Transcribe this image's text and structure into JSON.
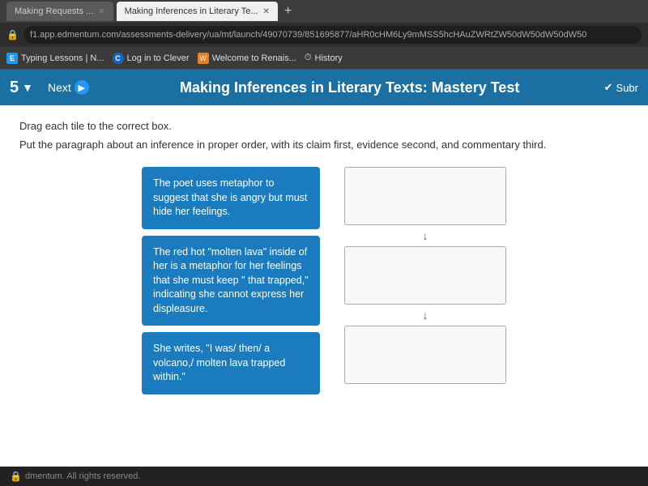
{
  "browser": {
    "tabs": [
      {
        "label": "Making Requests ...",
        "active": false
      },
      {
        "label": "Making Inferences in Literary Te...",
        "active": true
      }
    ],
    "address": "f1.app.edmentum.com/assessments-delivery/ua/mt/launch/49070739/851695877/aHR0cHM6Ly9mMSS5hcHAuZWRtZW50dW50dW50dW50",
    "bookmarks": [
      {
        "icon": "E",
        "label": "Typing Lessons | N...",
        "type": "e"
      },
      {
        "icon": "C",
        "label": "Log in to Clever",
        "type": "c"
      },
      {
        "icon": "W",
        "label": "Welcome to Renais...",
        "type": "w"
      },
      {
        "icon": "⏱",
        "label": "History",
        "type": "h"
      }
    ]
  },
  "header": {
    "question_number": "5",
    "next_label": "Next",
    "title": "Making Inferences in Literary Texts: Mastery Test",
    "submit_label": "Subr"
  },
  "content": {
    "drag_instruction": "Drag each tile to the correct box.",
    "order_instruction": "Put the paragraph about an inference in proper order, with its claim first, evidence second, and commentary third.",
    "tiles": [
      {
        "id": "tile1",
        "text": "The poet uses metaphor to suggest that she is angry but must hide her feelings."
      },
      {
        "id": "tile2",
        "text": "The red hot \"molten lava\" inside of her is a metaphor for her feelings that she must keep \" that trapped,\" indicating she cannot express her displeasure."
      },
      {
        "id": "tile3",
        "text": "She writes, \"I was/ then/ a volcano,/ molten lava trapped within.\""
      }
    ],
    "drop_zones": [
      {
        "id": "drop1",
        "label": ""
      },
      {
        "id": "drop2",
        "label": ""
      },
      {
        "id": "drop3",
        "label": ""
      }
    ]
  },
  "footer": {
    "copyright": "dmentum. All rights reserved."
  }
}
